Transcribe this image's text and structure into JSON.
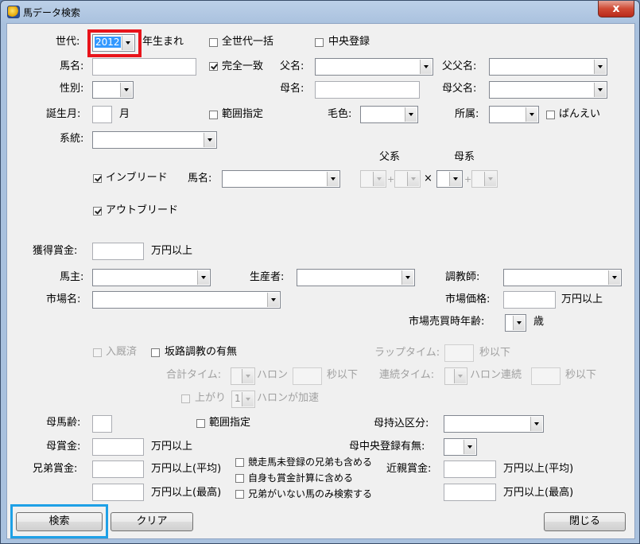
{
  "window": {
    "title": "馬データ検索",
    "close_label": "x"
  },
  "generation": {
    "label": "世代:",
    "value": "2012",
    "suffix": "年生まれ"
  },
  "checkbox": {
    "all_generations": "全世代一括",
    "central_registration": "中央登録",
    "exact_match": "完全一致",
    "range1": "範囲指定",
    "banei": "ばんえい",
    "inbreed": "インブリード",
    "outbreed": "アウトブリード",
    "retired": "入厩済",
    "slope_training": "坂路調教の有無",
    "agari": "上がり",
    "range2": "範囲指定",
    "sibling_opt1": "競走馬未登録の兄弟も含める",
    "sibling_opt2": "自身も賞金計算に含める",
    "sibling_opt3": "兄弟がいない馬のみ検索する"
  },
  "labels": {
    "horse_name": "馬名:",
    "sex": "性別:",
    "birth_month": "誕生月:",
    "month_unit": "月",
    "lineage": "系統:",
    "sire": "父名:",
    "dam": "母名:",
    "sire_sire": "父父名:",
    "dam_sire": "母父名:",
    "coat": "毛色:",
    "affiliation": "所属:",
    "inbreed_horse_name": "馬名:",
    "paternal": "父系",
    "maternal": "母系",
    "earnings": "獲得賞金:",
    "man_yen_over": "万円以上",
    "owner": "馬主:",
    "breeder": "生産者:",
    "trainer": "調教師:",
    "market_name": "市場名:",
    "market_price": "市場価格:",
    "market_price_unit": "万円以上",
    "market_age": "市場売買時年齢:",
    "age_unit": "歳",
    "lap_time": "ラップタイム:",
    "seconds_under": "秒以下",
    "total_time": "合計タイム:",
    "furlong": "ハロン",
    "total_seconds_under": "秒以下",
    "consecutive_time": "連続タイム:",
    "furlong_consecutive": "ハロン連続",
    "consecutive_seconds_under": "秒以下",
    "agari_furlong": "ハロンが加速",
    "dam_age": "母馬齢:",
    "dam_import": "母持込区分:",
    "dam_earnings": "母賞金:",
    "dam_earnings_unit": "万円以上",
    "dam_central": "母中央登録有無:",
    "sibling_earnings": "兄弟賞金:",
    "sibling_avg": "万円以上(平均)",
    "sibling_max": "万円以上(最高)",
    "relatives_earnings": "近親賞金:",
    "relatives_avg": "万円以上(平均)",
    "relatives_max": "万円以上(最高)"
  },
  "agari_value": "1",
  "buttons": {
    "search": "検索",
    "clear": "クリア",
    "close": "閉じる"
  },
  "cross_symbol": "×",
  "plus_symbol": "+",
  "colors": {
    "highlight_red": "#e8141b",
    "highlight_blue": "#1ea0e6",
    "selection": "#3399ff"
  }
}
